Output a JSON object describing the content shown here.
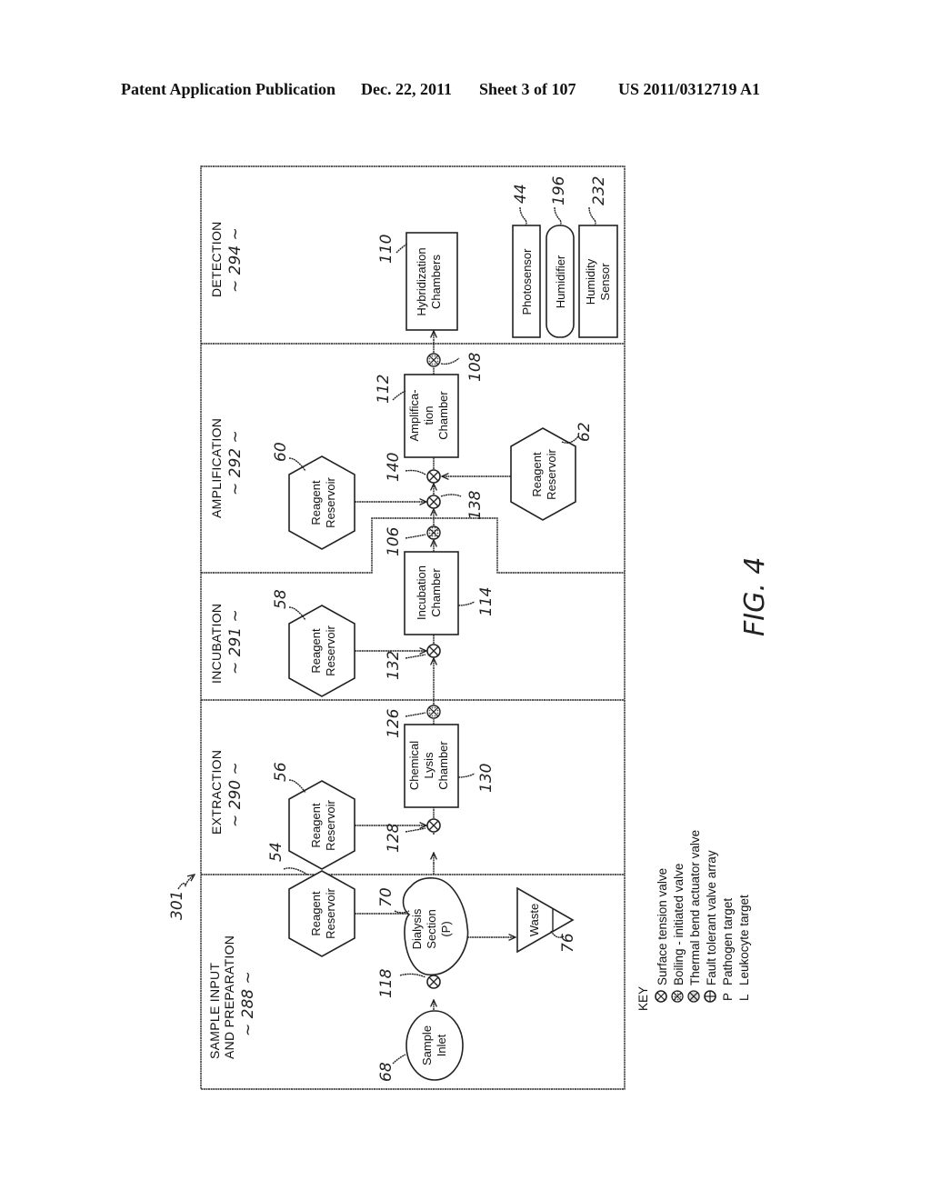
{
  "header": {
    "publication": "Patent Application Publication",
    "date": "Dec. 22, 2011",
    "sheet": "Sheet 3 of 107",
    "number": "US 2011/0312719 A1"
  },
  "figure": {
    "label": "FIG. 4",
    "system_ref": "301"
  },
  "lanes": [
    {
      "name": "SAMPLE INPUT",
      "name2": "AND PREPARATION",
      "ref": "~ 288 ~"
    },
    {
      "name": "EXTRACTION",
      "ref": "~ 290 ~"
    },
    {
      "name": "INCUBATION",
      "ref": "~ 291 ~"
    },
    {
      "name": "AMPLIFICATION",
      "ref": "~ 292 ~"
    },
    {
      "name": "DETECTION",
      "ref": "~ 294 ~"
    }
  ],
  "components": {
    "sample_inlet": {
      "line1": "Sample",
      "line2": "Inlet",
      "ref": "68"
    },
    "reservoir_54": {
      "line1": "Reagent",
      "line2": "Reservoir",
      "ref": "54"
    },
    "dialysis": {
      "line1": "Dialysis",
      "line2": "Section",
      "line3": "(P)",
      "ref": "70"
    },
    "waste": {
      "label": "Waste",
      "ref": "76"
    },
    "reservoir_56": {
      "line1": "Reagent",
      "line2": "Reservoir",
      "ref": "56"
    },
    "chemical_lysis": {
      "line1": "Chemical",
      "line2": "Lysis",
      "line3": "Chamber",
      "ref": "130"
    },
    "reservoir_58": {
      "line1": "Reagent",
      "line2": "Reservoir",
      "ref": "58"
    },
    "incubation": {
      "line1": "Incubation",
      "line2": "Chamber",
      "ref": "114"
    },
    "reservoir_60": {
      "line1": "Reagent",
      "line2": "Reservoir",
      "ref": "60"
    },
    "reservoir_62": {
      "line1": "Reagent",
      "line2": "Reservoir",
      "ref": "62"
    },
    "amplification": {
      "line1": "Amplifica-",
      "line2": "tion",
      "line3": "Chamber",
      "ref": "112"
    },
    "hybridization": {
      "line1": "Hybridization",
      "line2": "Chambers",
      "ref": "110"
    },
    "photosensor": {
      "label": "Photosensor",
      "ref": "44"
    },
    "humidifier": {
      "label": "Humidifier",
      "ref": "196"
    },
    "humidity_sensor": {
      "line1": "Humidity",
      "line2": "Sensor",
      "ref": "232"
    }
  },
  "valves": {
    "v118": "118",
    "v128": "128",
    "v126": "126",
    "v132": "132",
    "v106": "106",
    "v138": "138",
    "v140": "140",
    "v108": "108"
  },
  "key": {
    "title": "KEY",
    "items": [
      {
        "symbol": "surface-tension-valve",
        "label": "Surface tension valve"
      },
      {
        "symbol": "boiling-initiated-valve",
        "label": "Boiling - initiated valve"
      },
      {
        "symbol": "thermal-bend-actuator-valve",
        "label": "Thermal bend actuator valve"
      },
      {
        "symbol": "fault-tolerant-valve-array",
        "label": "Fault tolerant valve array"
      },
      {
        "symbol": "P",
        "label": "Pathogen target"
      },
      {
        "symbol": "L",
        "label": "Leukocyte target"
      }
    ]
  }
}
